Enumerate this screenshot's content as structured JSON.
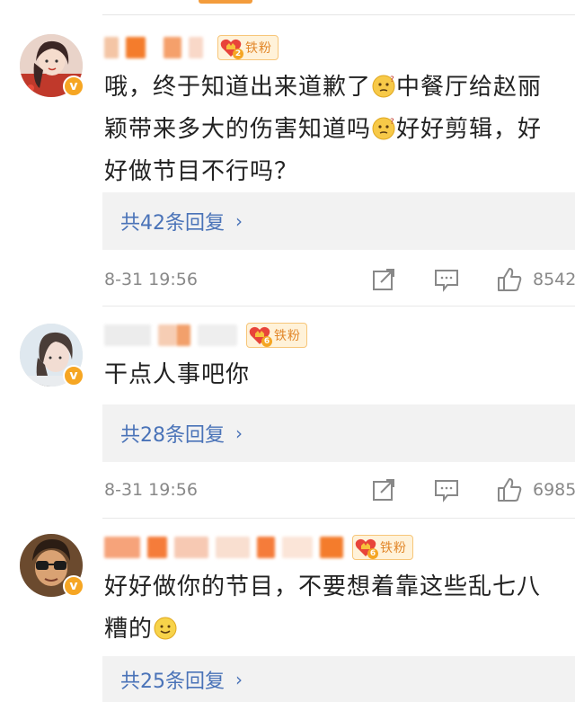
{
  "comments": [
    {
      "fan_level": "2",
      "fan_label": "铁粉",
      "text_parts": [
        "哦，终于知道出来道歉了",
        "中餐厅给赵丽颖带来多大的伤害知道吗",
        "好好剪辑，好好做节目不行吗？"
      ],
      "emoji": "thinking-emoji",
      "reply_label": "共42条回复",
      "reply_arrow": "›",
      "timestamp": "8-31 19:56",
      "likes": "8542"
    },
    {
      "fan_level": "6",
      "fan_label": "铁粉",
      "text": "干点人事吧你",
      "reply_label": "共28条回复",
      "reply_arrow": "›",
      "timestamp": "8-31 19:56",
      "likes": "6985"
    },
    {
      "fan_level": "6",
      "fan_label": "铁粉",
      "text_parts": [
        "好好做你的节目，不要想着靠这些乱七八糟的"
      ],
      "emoji": "smile-emoji",
      "reply_label": "共25条回复",
      "reply_arrow": "›"
    }
  ],
  "colors": {
    "reply_link": "#4a73b8",
    "badge_bg": "#fff2d9",
    "badge_text": "#e2872a",
    "verified": "#f6a623",
    "meta_text": "#888888"
  },
  "icons": [
    "share-icon",
    "comment-icon",
    "like-icon",
    "verified-icon",
    "fan-heart-icon"
  ]
}
